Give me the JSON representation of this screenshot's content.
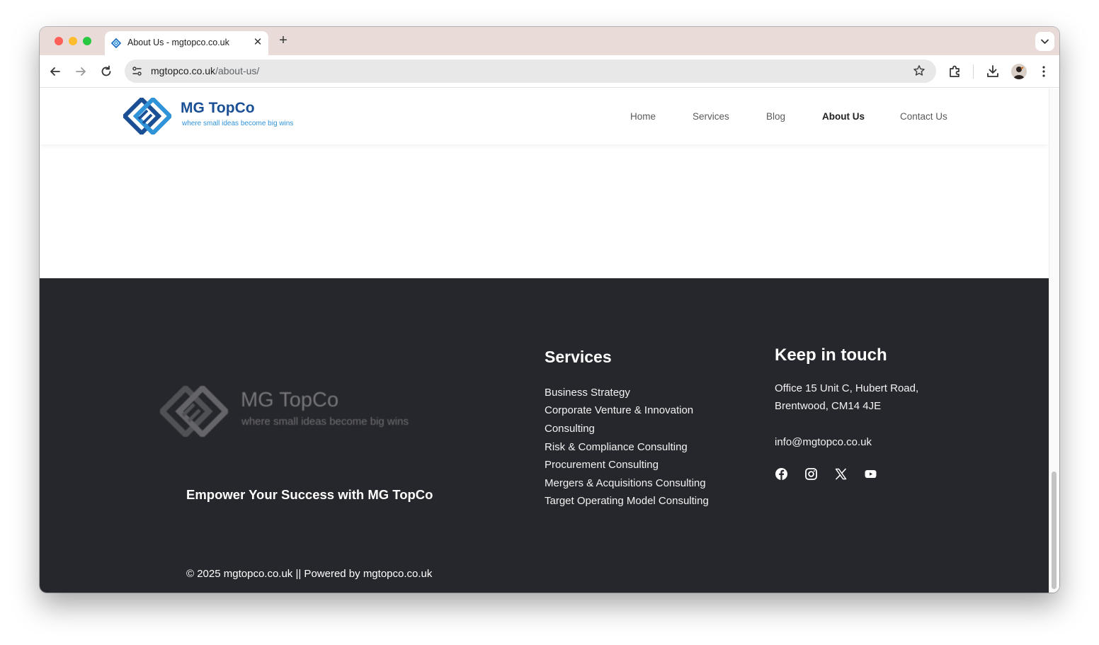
{
  "browser": {
    "tab_title": "About Us - mgtopco.co.uk",
    "url_domain": "mgtopco.co.uk",
    "url_path": "/about-us/",
    "tab_close_glyph": "✕",
    "new_tab_glyph": "+"
  },
  "site": {
    "logo_name": "MG TopCo",
    "logo_tagline": "where small ideas become big wins",
    "nav": [
      {
        "label": "Home"
      },
      {
        "label": "Services"
      },
      {
        "label": "Blog"
      },
      {
        "label": "About Us",
        "active": true
      },
      {
        "label": "Contact Us"
      }
    ]
  },
  "footer": {
    "logo_name": "MG TopCo",
    "logo_tagline": "where small ideas become big wins",
    "slogan": "Empower Your Success with MG TopCo",
    "services_heading": "Services",
    "services": [
      "Business Strategy",
      "Corporate Venture & Innovation",
      "Consulting",
      "Risk & Compliance Consulting",
      "Procurement Consulting",
      "Mergers & Acquisitions Consulting",
      "Target Operating Model Consulting"
    ],
    "contact_heading": "Keep in touch",
    "address_line1": "Office 15 Unit C, Hubert Road,",
    "address_line2": "Brentwood, CM14 4JE",
    "email": "info@mgtopco.co.uk",
    "social_icons": [
      "facebook-icon",
      "instagram-icon",
      "x-icon",
      "youtube-icon"
    ],
    "copyright": "© 2025 mgtopco.co.uk || Powered by mgtopco.co.uk"
  },
  "colors": {
    "brand_blue": "#1b4f95",
    "brand_light_blue": "#2f93d8",
    "footer_bg": "#26272c"
  }
}
